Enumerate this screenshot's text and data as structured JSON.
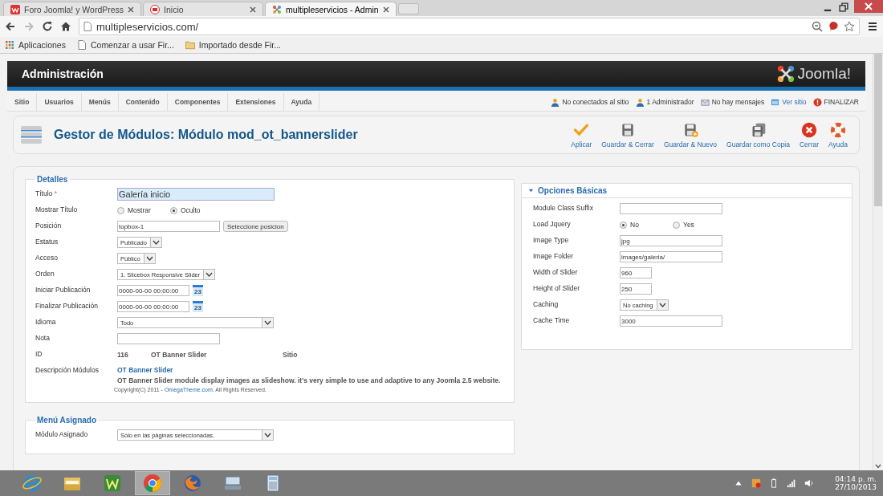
{
  "browser": {
    "tabs": [
      {
        "label": "Foro Joomla! y WordPress",
        "kind": "forum",
        "selected": false
      },
      {
        "label": "Inicio",
        "kind": "site",
        "selected": false
      },
      {
        "label": "multipleservicios - Admin",
        "kind": "joomla",
        "selected": true
      }
    ],
    "address": "multipleservicios.com/",
    "bookmarks": [
      {
        "label": "Aplicaciones",
        "kind": "apps"
      },
      {
        "label": "Comenzar a usar Fir...",
        "kind": "page"
      },
      {
        "label": "Importado desde Fir...",
        "kind": "folder"
      }
    ]
  },
  "admin": {
    "title": "Administración",
    "logo": "Joomla!",
    "menu": [
      "Sitio",
      "Usuarios",
      "Menús",
      "Contenido",
      "Componentes",
      "Extensiones",
      "Ayuda"
    ],
    "status": [
      {
        "text": "No conectados al sitio",
        "kind": "users"
      },
      {
        "text": "1 Administrador",
        "kind": "user"
      },
      {
        "text": "No hay mensajes",
        "kind": "mail"
      },
      {
        "text": "Ver sitio",
        "kind": "view"
      },
      {
        "text": "FINALIZAR",
        "kind": "logout"
      }
    ],
    "page_title": "Gestor de Módulos: Módulo mod_ot_bannerslider",
    "toolbar": [
      {
        "label": "Aplicar",
        "kind": "apply"
      },
      {
        "label": "Guardar & Cerrar",
        "kind": "save"
      },
      {
        "label": "Guardar & Nuevo",
        "kind": "save_new"
      },
      {
        "label": "Guardar como Copia",
        "kind": "save_copy"
      },
      {
        "label": "Cerrar",
        "kind": "close"
      },
      {
        "label": "Ayuda",
        "kind": "help"
      }
    ]
  },
  "details": {
    "title": "Detalles",
    "fields": [
      {
        "label": "Título",
        "required_mark": "*",
        "kind": "title",
        "value": "Galería inicio"
      },
      {
        "label": "Mostrar Título",
        "kind": "radio",
        "options": [
          {
            "label": "Mostrar",
            "selected": false
          },
          {
            "label": "Oculto",
            "selected": true
          }
        ]
      },
      {
        "label": "Posición",
        "kind": "text_button",
        "value": "topbox-1",
        "button": "Seleccione posicion"
      },
      {
        "label": "Estatus",
        "kind": "select",
        "value": "Publicado"
      },
      {
        "label": "Acceso",
        "kind": "select",
        "value": "Público"
      },
      {
        "label": "Orden",
        "kind": "select",
        "value": "1. Slicebox Responsive Slider"
      },
      {
        "label": "Iniciar Publicación",
        "kind": "date",
        "value": "0000-00-00 00:00:00",
        "calendar_day": "23"
      },
      {
        "label": "Finalizar Publicación",
        "kind": "date",
        "value": "0000-00-00 00:00:00",
        "calendar_day": "23"
      },
      {
        "label": "Idioma",
        "kind": "select_wide",
        "value": "Todo"
      },
      {
        "label": "Nota",
        "kind": "text"
      },
      {
        "label": "ID",
        "kind": "id",
        "values": [
          "116",
          "OT Banner Slider",
          "Sitio"
        ]
      },
      {
        "label": "Descripción Módulos",
        "kind": "description",
        "heading": "OT Banner Slider",
        "text": "OT Banner Slider module display images as slideshow. it's very simple to use and adaptive to any Joomla 2.5 website.",
        "copyright_before": "Copyright(C) 2011 - ",
        "copyright_link": "OmegaTheme.com",
        "copyright_after": ". All Rights Reserved."
      }
    ]
  },
  "menu_assignment": {
    "title": "Menú Asignado",
    "fields": [
      {
        "label": "Módulo Asignado",
        "kind": "select_wide",
        "value": "Sólo en las páginas seleccionadas."
      }
    ]
  },
  "basic_options": {
    "title": "Opciones Básicas",
    "expanded": true,
    "fields": [
      {
        "label": "Module Class Suffix",
        "kind": "text"
      },
      {
        "label": "Load Jquery",
        "kind": "radio",
        "options": [
          {
            "label": "No",
            "selected": true
          },
          {
            "label": "Yes",
            "selected": false
          }
        ]
      },
      {
        "label": "Image Type",
        "kind": "text",
        "value": "jpg"
      },
      {
        "label": "Image Folder",
        "kind": "text",
        "value": "images/galeria/"
      },
      {
        "label": "Width of Slider",
        "kind": "number",
        "value": "960"
      },
      {
        "label": "Height of Slider",
        "kind": "number",
        "value": "250"
      },
      {
        "label": "Caching",
        "kind": "select",
        "value": "No caching"
      },
      {
        "label": "Cache Time",
        "kind": "text",
        "value": "3000"
      }
    ]
  },
  "taskbar": {
    "apps": [
      {
        "kind": "ie",
        "selected": false
      },
      {
        "kind": "explorer",
        "selected": false
      },
      {
        "kind": "w",
        "selected": false
      },
      {
        "kind": "chrome",
        "selected": true
      },
      {
        "kind": "firefox",
        "selected": false
      },
      {
        "kind": "keyboard",
        "selected": false
      },
      {
        "kind": "calculator",
        "selected": false
      }
    ],
    "time": "04:14 p. m.",
    "date": "27/10/2013"
  }
}
